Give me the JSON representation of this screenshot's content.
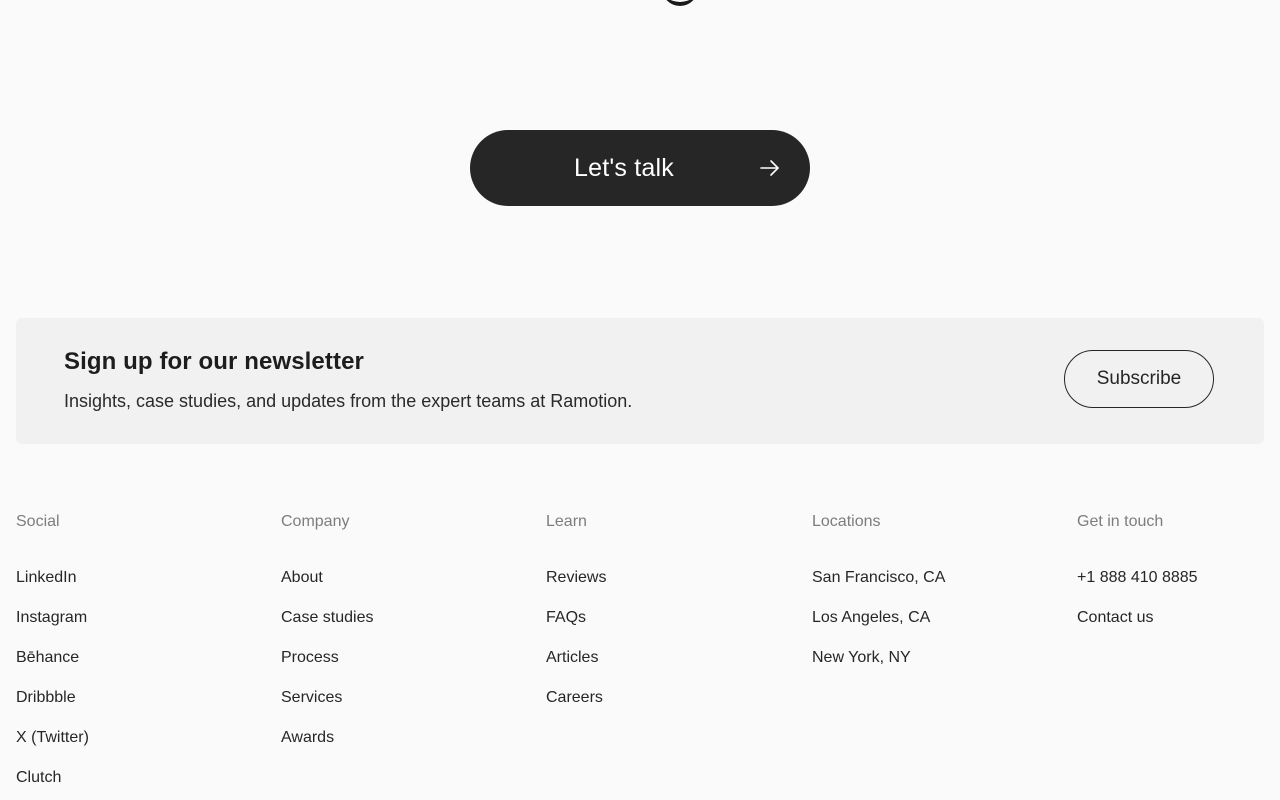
{
  "cta": {
    "label": "Let's talk",
    "icon": "arrow-right-icon"
  },
  "newsletter": {
    "title": "Sign up for our newsletter",
    "description": "Insights, case studies, and updates from the expert teams at Ramotion.",
    "button_label": "Subscribe"
  },
  "footer": {
    "social": {
      "heading": "Social",
      "items": [
        "LinkedIn",
        "Instagram",
        "Bēhance",
        "Dribbble",
        "X (Twitter)",
        "Clutch"
      ]
    },
    "company": {
      "heading": "Company",
      "items": [
        "About",
        "Case studies",
        "Process",
        "Services",
        "Awards"
      ]
    },
    "learn": {
      "heading": "Learn",
      "items": [
        "Reviews",
        "FAQs",
        "Articles",
        "Careers"
      ]
    },
    "locations": {
      "heading": "Locations",
      "items": [
        "San Francisco, CA",
        "Los Angeles, CA",
        "New York, NY"
      ]
    },
    "contact": {
      "heading": "Get in touch",
      "items": [
        "+1 888 410 8885",
        "Contact us"
      ]
    }
  },
  "colors": {
    "background": "#fafafa",
    "button_dark": "#262626",
    "panel": "#f1f1f1",
    "muted_text": "#7d7d7d"
  }
}
